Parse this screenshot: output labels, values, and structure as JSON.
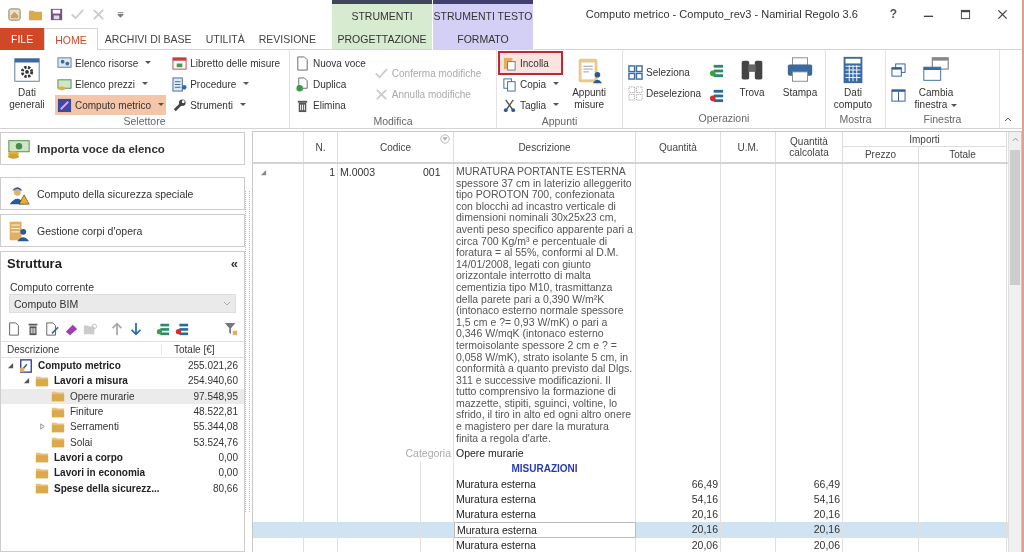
{
  "window": {
    "title": "Computo metrico - Computo_rev3 - Namirial Regolo 3.6",
    "help": "?"
  },
  "context_groups": [
    {
      "header": "STRUMENTI",
      "tab": "PROGETTAZIONE",
      "color": "#d6ebcf",
      "selected": false
    },
    {
      "header": "STRUMENTI TESTO",
      "tab": "FORMATO",
      "color": "#d3cff5",
      "selected": false
    }
  ],
  "tabs": [
    {
      "label": "FILE",
      "kind": "file",
      "selected": false
    },
    {
      "label": "HOME",
      "kind": "normal",
      "selected": true
    },
    {
      "label": "ARCHIVI DI BASE",
      "kind": "normal",
      "selected": false
    },
    {
      "label": "UTILITÀ",
      "kind": "normal",
      "selected": false
    },
    {
      "label": "REVISIONE",
      "kind": "normal",
      "selected": false
    }
  ],
  "ribbon": {
    "groups": [
      {
        "label": "Selettore",
        "columns": [
          {
            "kind": "large",
            "label": "Dati generali"
          },
          {
            "kind": "stack",
            "items": [
              {
                "label": "Elenco risorse",
                "dropdown": true,
                "selected": false
              },
              {
                "label": "Elenco prezzi",
                "dropdown": true,
                "selected": false
              },
              {
                "label": "Computo metrico",
                "dropdown": true,
                "selected": true
              }
            ]
          },
          {
            "kind": "stack",
            "items": [
              {
                "label": "Libretto delle misure",
                "selected": false
              },
              {
                "label": "Procedure",
                "dropdown": true,
                "selected": false
              },
              {
                "label": "Strumenti",
                "dropdown": true,
                "selected": false
              }
            ]
          }
        ]
      },
      {
        "label": "Modifica",
        "columns": [
          {
            "kind": "stack",
            "items": [
              {
                "label": "Nuova voce",
                "disabled": false
              },
              {
                "label": "Duplica",
                "disabled": false
              },
              {
                "label": "Elimina",
                "disabled": false
              }
            ]
          },
          {
            "kind": "stack",
            "items": [
              {
                "label": "Conferma modifiche",
                "disabled": true
              },
              {
                "label": "Annulla modifiche",
                "disabled": true
              }
            ]
          }
        ]
      },
      {
        "label": "Appunti",
        "columns": [
          {
            "kind": "stack",
            "items": [
              {
                "label": "Incolla",
                "outlined": true
              },
              {
                "label": "Copia",
                "dropdown": true
              },
              {
                "label": "Taglia",
                "dropdown": true
              }
            ]
          },
          {
            "kind": "large",
            "label": "Appunti misure"
          }
        ]
      },
      {
        "label": "Operazioni",
        "columns": [
          {
            "kind": "stack",
            "items": [
              {
                "label": "Seleziona"
              },
              {
                "label": "Deseleziona"
              }
            ]
          },
          {
            "kind": "icons"
          },
          {
            "kind": "large",
            "label": "Trova"
          },
          {
            "kind": "large",
            "label": "Stampa"
          }
        ]
      },
      {
        "label": "Mostra",
        "columns": [
          {
            "kind": "large",
            "label": "Dati computo"
          }
        ]
      },
      {
        "label": "Finestra",
        "columns": [
          {
            "kind": "icons"
          },
          {
            "kind": "large",
            "label": "Cambia finestra",
            "dropdown": true
          }
        ]
      }
    ]
  },
  "left_panel": {
    "actions": [
      {
        "label": "Importa voce da elenco",
        "kind": "primary"
      },
      {
        "label": "Computo della sicurezza speciale",
        "kind": "normal"
      },
      {
        "label": "Gestione corpi d'opera",
        "kind": "normal"
      }
    ],
    "structure": {
      "title": "Struttura",
      "collapse": "«",
      "current_label": "Computo corrente",
      "current_value": "Computo BIM",
      "columns": [
        "Descrizione",
        "Totale [€]"
      ],
      "tree": [
        {
          "label": "Computo metrico",
          "total": "255.021,26",
          "kind": "computo",
          "expanded": true,
          "selected": false,
          "children": [
            {
              "label": "Lavori a misura",
              "total": "254.940,60",
              "kind": "group",
              "expanded": true,
              "selected": false,
              "children": [
                {
                  "label": "Opere murarie",
                  "total": "97.548,95",
                  "kind": "subgroup",
                  "selected": true
                },
                {
                  "label": "Finiture",
                  "total": "48.522,81",
                  "kind": "subgroup",
                  "selected": false
                },
                {
                  "label": "Serramenti",
                  "total": "55.344,08",
                  "kind": "subgroup",
                  "expanded": false,
                  "selected": false
                },
                {
                  "label": "Solai",
                  "total": "53.524,76",
                  "kind": "subgroup",
                  "selected": false
                }
              ]
            },
            {
              "label": "Lavori a corpo",
              "total": "0,00",
              "kind": "group",
              "selected": false
            },
            {
              "label": "Lavori in economia",
              "total": "0,00",
              "kind": "group",
              "selected": false
            },
            {
              "label": "Spese della sicurezz...",
              "total": "80,66",
              "kind": "group",
              "selected": false
            }
          ]
        }
      ]
    }
  },
  "table": {
    "header": {
      "number": "N.",
      "code": "Codice",
      "description": "Descrizione",
      "quantity": "Quantità",
      "unit": "U.M.",
      "calculated": "Quantità calcolata",
      "amounts": "Importi",
      "price": "Prezzo",
      "total": "Totale"
    },
    "rows": [
      {
        "kind": "item",
        "expanded": true,
        "number": "1",
        "code": "M.0003",
        "subcode": "001",
        "description": "MURATURA PORTANTE ESTERNA\nspessore 37 cm in laterizio alleggerito tipo POROTON 700, confezionata con blocchi ad incastro verticale di dimensioni nominali 30x25x23 cm, aventi peso specifico apparente pari a circa 700 Kg/m³ e percentuale di foratura = al 55%, conformi al D.M. 14/01/2008, legati con giunto orizzontale interrotto di malta cementizia tipo M10, trasmittanza della parete pari a 0,390 W/m²K (intonaco esterno normale spessore 1,5 cm e ?= 0,93 W/mK) o pari a 0,346 W/mqK (intonaco esterno termoisolante spessore 2 cm e ? = 0,058 W/mK), strato isolante 5 cm, in conformità a quanto previsto dal Dlgs. 311 e successive modificazioni. Il tutto comprensivo la formazione di mazzette, stipiti, sguinci, voltine, lo sfrido, il tiro in alto ed ogni altro onere e magistero per dare la muratura finita a regola d'arte."
      },
      {
        "kind": "category",
        "label": "Categoria",
        "value": "Opere murarie"
      },
      {
        "kind": "section",
        "label": "MISURAZIONI"
      },
      {
        "kind": "measure",
        "description": "Muratura esterna",
        "quantity": "66,49",
        "calculated": "66,49",
        "selected": false
      },
      {
        "kind": "measure",
        "description": "Muratura esterna",
        "quantity": "54,16",
        "calculated": "54,16",
        "selected": false
      },
      {
        "kind": "measure",
        "description": "Muratura esterna",
        "quantity": "20,16",
        "calculated": "20,16",
        "selected": false
      },
      {
        "kind": "measure",
        "description": "Muratura esterna",
        "quantity": "20,16",
        "calculated": "20,16",
        "selected": true
      },
      {
        "kind": "measure",
        "description": "Muratura esterna",
        "quantity": "20,06",
        "calculated": "20,06",
        "selected": false
      }
    ]
  }
}
